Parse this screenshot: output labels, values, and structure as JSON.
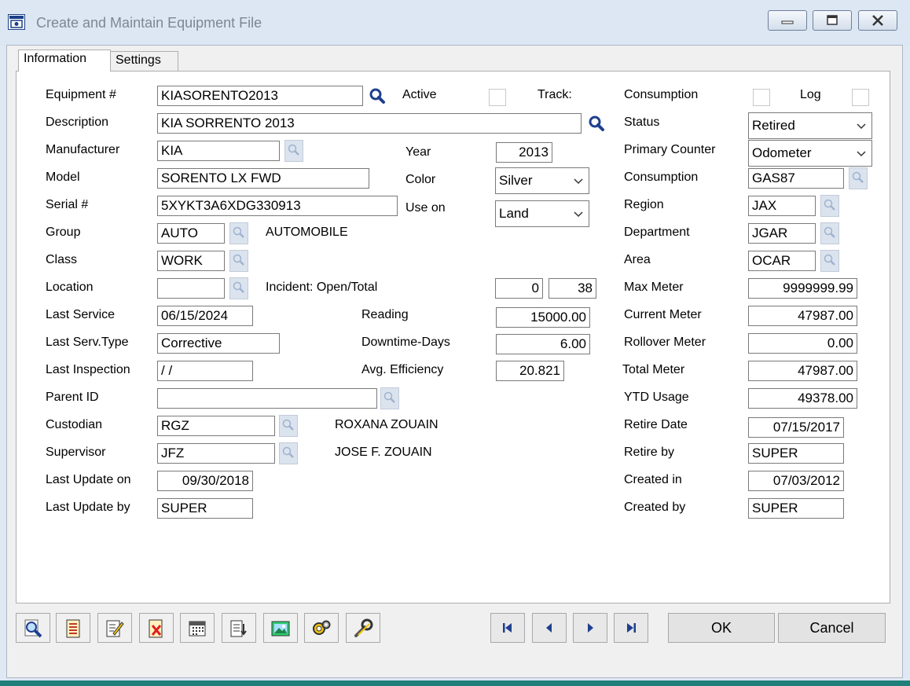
{
  "window": {
    "title": "Create and Maintain Equipment File"
  },
  "tabs": [
    {
      "label": "Information"
    },
    {
      "label": "Settings"
    }
  ],
  "left": {
    "equipment_label": "Equipment #",
    "equipment_value": "KIASORENTO2013",
    "description_label": "Description",
    "description_value": "KIA SORRENTO 2013",
    "manufacturer_label": "Manufacturer",
    "manufacturer_value": "KIA",
    "model_label": "Model",
    "model_value": "SORENTO  LX FWD",
    "serial_label": "Serial #",
    "serial_value": "5XYKT3A6XDG330913",
    "group_label": "Group",
    "group_value": "AUTO",
    "group_desc": "AUTOMOBILE",
    "class_label": "Class",
    "class_value": "WORK",
    "location_label": "Location",
    "location_value": "",
    "last_service_label": "Last Service",
    "last_service_value": "06/15/2024",
    "last_serv_type_label": "Last Serv.Type",
    "last_serv_type_value": "Corrective",
    "last_inspection_label": "Last Inspection",
    "last_inspection_value": " / /",
    "parent_id_label": "Parent ID",
    "parent_id_value": "",
    "custodian_label": "Custodian",
    "custodian_value": "RGZ",
    "custodian_name": "ROXANA ZOUAIN",
    "supervisor_label": "Supervisor",
    "supervisor_value": "JFZ",
    "supervisor_name": "JOSE F. ZOUAIN",
    "last_update_on_label": "Last Update on",
    "last_update_on_value": "09/30/2018",
    "last_update_by_label": "Last Update by",
    "last_update_by_value": "SUPER"
  },
  "middle": {
    "active_label": "Active",
    "track_label": "Track:",
    "year_label": "Year",
    "year_value": "2013",
    "color_label": "Color",
    "color_value": "Silver",
    "use_on_label": "Use on",
    "use_on_value": "Land",
    "incident_label": "Incident: Open/Total",
    "incident_open": "0",
    "incident_total": "38",
    "reading_label": "Reading",
    "reading_value": "15000.00",
    "downtime_label": "Downtime-Days",
    "downtime_value": "6.00",
    "avg_eff_label": "Avg. Efficiency",
    "avg_eff_value": "20.821"
  },
  "right": {
    "consumption_chk_label": "Consumption",
    "log_label": "Log",
    "status_label": "Status",
    "status_value": "Retired",
    "primary_counter_label": "Primary Counter",
    "primary_counter_value": "Odometer",
    "consumption_label": "Consumption",
    "consumption_value": "GAS87",
    "region_label": "Region",
    "region_value": "JAX",
    "department_label": "Department",
    "department_value": "JGAR",
    "area_label": "Area",
    "area_value": "OCAR",
    "max_meter_label": "Max Meter",
    "max_meter_value": "9999999.99",
    "current_meter_label": "Current Meter",
    "current_meter_value": "47987.00",
    "rollover_meter_label": "Rollover Meter",
    "rollover_meter_value": "0.00",
    "total_meter_label": "Total Meter",
    "total_meter_value": "47987.00",
    "ytd_usage_label": "YTD Usage",
    "ytd_usage_value": "49378.00",
    "retire_date_label": "Retire Date",
    "retire_date_value": "07/15/2017",
    "retire_by_label": "Retire by",
    "retire_by_value": "SUPER",
    "created_in_label": "Created in",
    "created_in_value": "07/03/2012",
    "created_by_label": "Created by",
    "created_by_value": "SUPER"
  },
  "buttons": {
    "ok": "OK",
    "cancel": "Cancel"
  }
}
